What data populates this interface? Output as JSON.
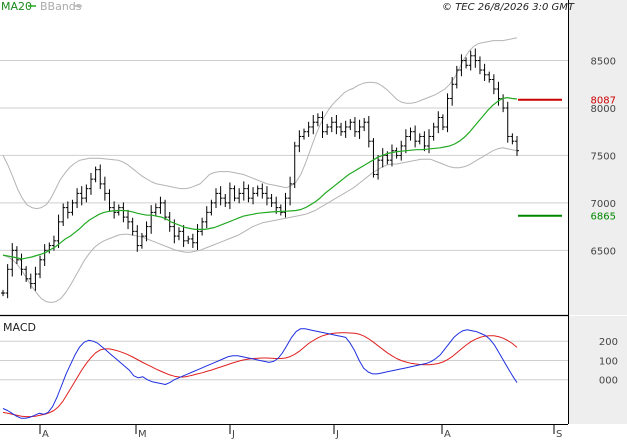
{
  "header": {
    "ma_label": "MA20",
    "bb_label": "BBands",
    "copyright": "© TEC 26/8/2026 3:0 GMT"
  },
  "colors": {
    "price": "#000000",
    "ma20": "#22aa22",
    "bbands": "#b4b4b4",
    "macd_line": "#1f2fe0",
    "signal_line": "#e02020",
    "resistance": "#cc0000",
    "support": "#008800",
    "grid": "#cfcfcf",
    "band_bg": "#eeeeee"
  },
  "chart_data": [
    {
      "type": "line",
      "panel": "price",
      "title": "",
      "x_ticks": [
        "A",
        "M",
        "J",
        "J",
        "A",
        "S"
      ],
      "y_ticks": [
        8500,
        8000,
        7500,
        7000,
        6500
      ],
      "y_tick_labels": [
        "8500",
        "8000",
        "7500",
        "7000",
        "6500"
      ],
      "ylim": [
        5850,
        8980
      ],
      "grid": true,
      "levels": [
        {
          "name": "resistance",
          "value": 8087,
          "label": "8087"
        },
        {
          "name": "support",
          "value": 6865,
          "label": "6865"
        }
      ],
      "series": [
        {
          "name": "MA20",
          "values": [
            6450,
            6440,
            6430,
            6420,
            6410,
            6420,
            6430,
            6445,
            6460,
            6480,
            6510,
            6540,
            6580,
            6620,
            6650,
            6690,
            6730,
            6780,
            6820,
            6850,
            6880,
            6900,
            6910,
            6915,
            6920,
            6920,
            6915,
            6905,
            6890,
            6880,
            6870,
            6870,
            6860,
            6850,
            6830,
            6800,
            6780,
            6760,
            6740,
            6730,
            6720,
            6720,
            6720,
            6730,
            6740,
            6760,
            6780,
            6800,
            6820,
            6840,
            6860,
            6870,
            6880,
            6890,
            6895,
            6900,
            6905,
            6908,
            6910,
            6912,
            6915,
            6920,
            6930,
            6950,
            6980,
            7010,
            7050,
            7100,
            7140,
            7180,
            7220,
            7260,
            7300,
            7330,
            7360,
            7390,
            7420,
            7450,
            7480,
            7500,
            7520,
            7530,
            7540,
            7545,
            7550,
            7555,
            7560,
            7560,
            7565,
            7570,
            7575,
            7580,
            7590,
            7600,
            7620,
            7650,
            7690,
            7740,
            7800,
            7860,
            7920,
            7980,
            8030,
            8070,
            8100,
            8110,
            8100,
            8095
          ]
        },
        {
          "name": "BBands upper",
          "values": [
            7500,
            7400,
            7280,
            7150,
            7050,
            6980,
            6950,
            6940,
            6950,
            6980,
            7050,
            7150,
            7250,
            7320,
            7380,
            7420,
            7450,
            7460,
            7470,
            7470,
            7470,
            7465,
            7460,
            7455,
            7450,
            7430,
            7400,
            7360,
            7320,
            7280,
            7250,
            7220,
            7200,
            7190,
            7180,
            7170,
            7160,
            7150,
            7150,
            7160,
            7180,
            7200,
            7250,
            7300,
            7320,
            7330,
            7330,
            7330,
            7320,
            7310,
            7300,
            7280,
            7260,
            7240,
            7220,
            7200,
            7190,
            7180,
            7170,
            7160,
            7180,
            7220,
            7300,
            7420,
            7560,
            7700,
            7820,
            7920,
            8000,
            8060,
            8110,
            8160,
            8190,
            8210,
            8240,
            8260,
            8270,
            8270,
            8260,
            8230,
            8190,
            8140,
            8090,
            8060,
            8050,
            8050,
            8060,
            8080,
            8100,
            8120,
            8140,
            8170,
            8200,
            8250,
            8320,
            8420,
            8520,
            8600,
            8650,
            8680,
            8690,
            8700,
            8710,
            8710,
            8710,
            8720,
            8730,
            8740
          ]
        },
        {
          "name": "BBands lower",
          "values": [
            6450,
            6430,
            6400,
            6350,
            6280,
            6200,
            6120,
            6050,
            5990,
            5960,
            5950,
            5960,
            5990,
            6050,
            6130,
            6220,
            6310,
            6400,
            6470,
            6530,
            6570,
            6600,
            6620,
            6640,
            6660,
            6670,
            6670,
            6660,
            6650,
            6640,
            6620,
            6600,
            6580,
            6560,
            6540,
            6520,
            6500,
            6490,
            6480,
            6480,
            6490,
            6500,
            6520,
            6540,
            6560,
            6580,
            6600,
            6620,
            6640,
            6660,
            6690,
            6720,
            6750,
            6770,
            6790,
            6800,
            6810,
            6820,
            6830,
            6840,
            6850,
            6860,
            6870,
            6880,
            6900,
            6920,
            6950,
            6980,
            7010,
            7040,
            7070,
            7100,
            7130,
            7160,
            7200,
            7240,
            7280,
            7320,
            7350,
            7380,
            7400,
            7410,
            7410,
            7420,
            7430,
            7440,
            7450,
            7460,
            7460,
            7460,
            7440,
            7420,
            7400,
            7380,
            7370,
            7370,
            7380,
            7400,
            7430,
            7460,
            7490,
            7520,
            7550,
            7570,
            7580,
            7570,
            7560,
            7550
          ]
        },
        {
          "name": "Price",
          "values": [
            6050,
            6300,
            6500,
            6400,
            6300,
            6200,
            6150,
            6250,
            6400,
            6500,
            6550,
            6600,
            6800,
            6950,
            6900,
            7000,
            7100,
            7050,
            7150,
            7250,
            7350,
            7200,
            7100,
            6950,
            6900,
            6950,
            6850,
            6800,
            6700,
            6550,
            6650,
            6750,
            6900,
            6950,
            7000,
            6850,
            6750,
            6650,
            6700,
            6600,
            6620,
            6580,
            6700,
            6800,
            6900,
            7000,
            7100,
            7050,
            7000,
            7150,
            7050,
            7100,
            7150,
            7050,
            7100,
            7150,
            7100,
            7050,
            7000,
            6950,
            6900,
            7050,
            7200,
            7600,
            7700,
            7750,
            7800,
            7850,
            7900,
            7750,
            7800,
            7850,
            7800,
            7750,
            7800,
            7850,
            7750,
            7800,
            7850,
            7650,
            7300,
            7450,
            7500,
            7450,
            7550,
            7500,
            7600,
            7700,
            7750,
            7650,
            7700,
            7600,
            7700,
            7800,
            7900,
            7800,
            8100,
            8250,
            8400,
            8500,
            8450,
            8550,
            8500,
            8400,
            8350,
            8300,
            8200,
            8100,
            8000,
            7700,
            7650,
            7550
          ]
        }
      ]
    },
    {
      "type": "line",
      "panel": "macd",
      "title": "MACD",
      "x_ticks": [
        "A",
        "M",
        "J",
        "J",
        "A",
        "S"
      ],
      "y_ticks": [
        200,
        100,
        0
      ],
      "y_tick_labels": [
        "200",
        "100",
        "000"
      ],
      "ylim": [
        -220,
        300
      ],
      "series": [
        {
          "name": "MACD",
          "values": [
            -150,
            -160,
            -175,
            -190,
            -200,
            -200,
            -195,
            -185,
            -175,
            -180,
            -170,
            -140,
            -90,
            -30,
            30,
            80,
            130,
            170,
            195,
            205,
            200,
            190,
            170,
            150,
            130,
            110,
            90,
            70,
            50,
            20,
            10,
            15,
            0,
            -10,
            -15,
            -20,
            -25,
            -15,
            0,
            10,
            20,
            30,
            40,
            50,
            60,
            70,
            80,
            90,
            100,
            110,
            120,
            125,
            125,
            120,
            115,
            110,
            105,
            100,
            95,
            90,
            95,
            110,
            140,
            180,
            220,
            250,
            265,
            265,
            260,
            255,
            250,
            245,
            240,
            235,
            230,
            225,
            220,
            190,
            150,
            100,
            60,
            40,
            30,
            30,
            35,
            40,
            45,
            50,
            55,
            60,
            65,
            70,
            75,
            80,
            85,
            95,
            110,
            130,
            160,
            190,
            220,
            240,
            255,
            260,
            255,
            250,
            240,
            230,
            210,
            180,
            140,
            100,
            60,
            20,
            -15
          ]
        },
        {
          "name": "Signal",
          "values": [
            -170,
            -175,
            -180,
            -185,
            -190,
            -192,
            -192,
            -190,
            -185,
            -180,
            -172,
            -160,
            -140,
            -110,
            -70,
            -30,
            10,
            50,
            85,
            115,
            140,
            155,
            160,
            160,
            155,
            148,
            140,
            130,
            118,
            105,
            92,
            80,
            68,
            56,
            45,
            35,
            25,
            18,
            14,
            14,
            18,
            24,
            30,
            36,
            43,
            50,
            58,
            66,
            74,
            82,
            90,
            97,
            103,
            107,
            110,
            112,
            113,
            113,
            112,
            110,
            110,
            113,
            120,
            132,
            148,
            168,
            188,
            204,
            218,
            228,
            235,
            240,
            243,
            244,
            244,
            243,
            241,
            236,
            226,
            212,
            195,
            176,
            158,
            140,
            124,
            110,
            100,
            92,
            86,
            82,
            79,
            78,
            78,
            80,
            84,
            92,
            104,
            120,
            140,
            160,
            180,
            197,
            210,
            220,
            226,
            229,
            228,
            224,
            216,
            204,
            188,
            168
          ]
        }
      ]
    }
  ]
}
